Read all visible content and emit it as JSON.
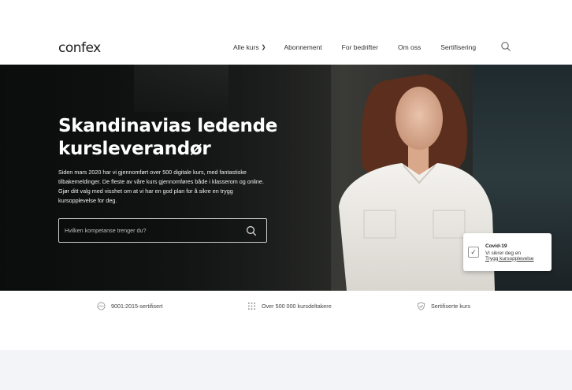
{
  "header": {
    "logo": "confex",
    "nav": [
      {
        "label": "Alle kurs",
        "has_dropdown": true
      },
      {
        "label": "Abonnement"
      },
      {
        "label": "For bedrifter"
      },
      {
        "label": "Om oss"
      },
      {
        "label": "Sertifisering"
      }
    ],
    "search_icon": "search-icon"
  },
  "hero": {
    "title": "Skandinavias ledende kursleverandør",
    "body": "Siden mars 2020 har vi gjennomført over 500 digitale kurs, med fantastiske tilbakemeldinger. De fleste av våre kurs gjennomføres både i klasserom og online. Gjør ditt valg med visshet om at vi har en god plan for å sikre en trygg kursopplevelse for deg.",
    "search": {
      "placeholder": "Hvilken kompetanse trenger du?"
    }
  },
  "covid_card": {
    "title": "Covid-19",
    "line1": "Vi sikrer deg en",
    "link": "Trygg kursopplevelse"
  },
  "features": [
    {
      "icon": "iso-badge-icon",
      "label": "9001:2015-sertifisert"
    },
    {
      "icon": "people-grid-icon",
      "label": "Over 500 000 kursdeltakere"
    },
    {
      "icon": "shield-check-icon",
      "label": "Sertifiserte kurs"
    }
  ]
}
